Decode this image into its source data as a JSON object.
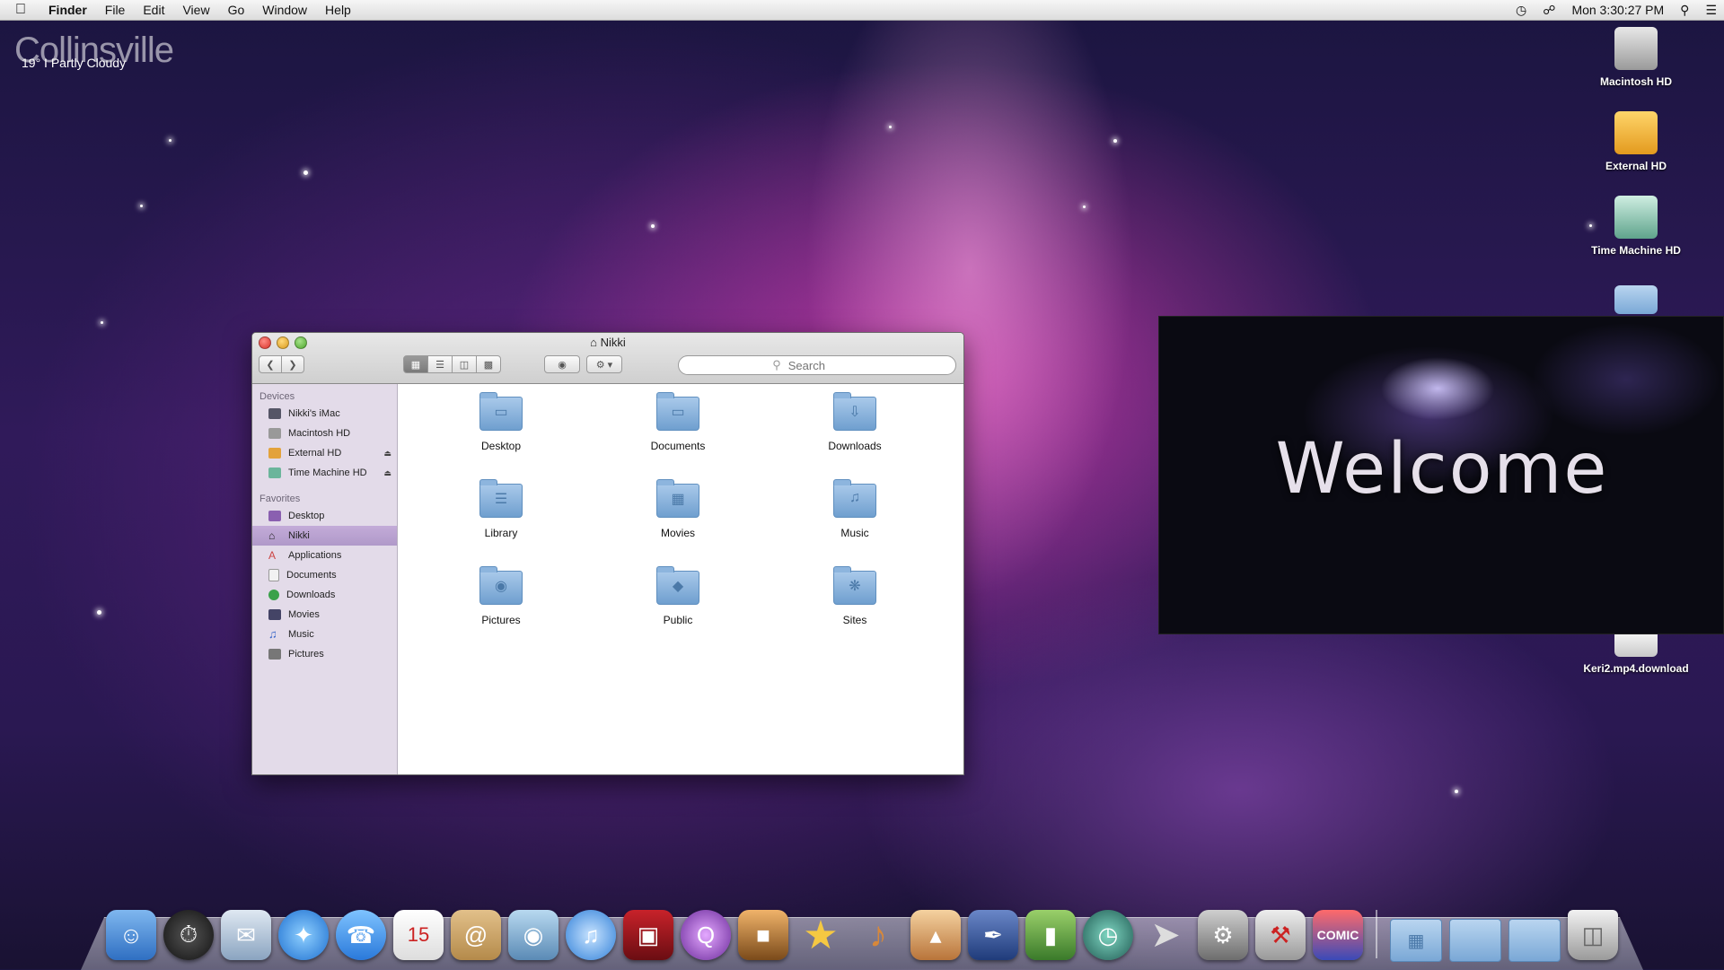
{
  "menubar": {
    "app": "Finder",
    "items": [
      "File",
      "Edit",
      "View",
      "Go",
      "Window",
      "Help"
    ],
    "clock": "Mon 3:30:27 PM"
  },
  "weather": {
    "city": "Collinsville",
    "condition": "19° I Partly Cloudy"
  },
  "desktop_icons": [
    "Macintosh HD",
    "External HD",
    "Time Machine HD",
    "Keri2.mp4.download"
  ],
  "finder": {
    "title": "Nikki",
    "search_placeholder": "Search",
    "sidebar": {
      "devices_header": "Devices",
      "devices": [
        "Nikki's iMac",
        "Macintosh HD",
        "External HD",
        "Time Machine HD"
      ],
      "favorites_header": "Favorites",
      "favorites": [
        "Desktop",
        "Nikki",
        "Applications",
        "Documents",
        "Downloads",
        "Movies",
        "Music",
        "Pictures"
      ]
    },
    "folders": [
      "Desktop",
      "Documents",
      "Downloads",
      "Library",
      "Movies",
      "Music",
      "Pictures",
      "Public",
      "Sites"
    ]
  },
  "welcome": {
    "text": "Welcome"
  },
  "colors": {
    "sidebar_bg": "#e3dbe9",
    "selection": "#b099c9",
    "folder_blue": "#7aa8d6"
  }
}
